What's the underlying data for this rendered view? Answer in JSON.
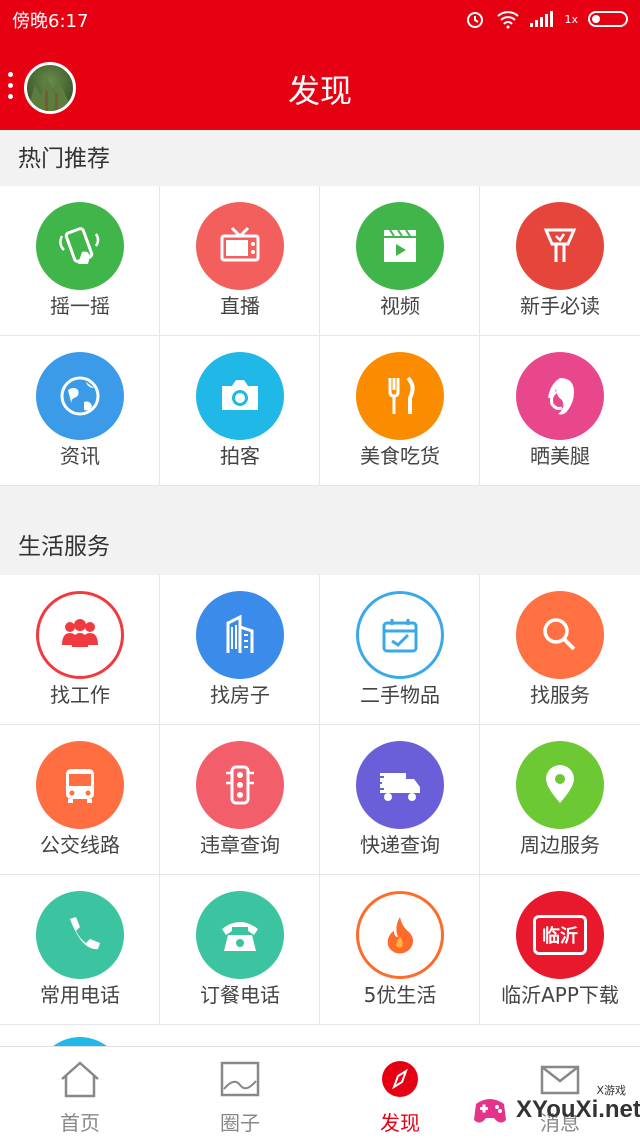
{
  "status": {
    "time": "傍晚6:17",
    "signal": "1x"
  },
  "header": {
    "title": "发现"
  },
  "sections": [
    {
      "title": "热门推荐",
      "items": [
        {
          "label": "摇一摇",
          "icon": "shake-phone-icon",
          "color": "#3fb54a"
        },
        {
          "label": "直播",
          "icon": "tv-icon",
          "color": "#f25f5c"
        },
        {
          "label": "视频",
          "icon": "video-clapper-icon",
          "color": "#3fb54a"
        },
        {
          "label": "新手必读",
          "icon": "guide-icon",
          "color": "#e5453a"
        },
        {
          "label": "资讯",
          "icon": "globe-icon",
          "color": "#3b9be8"
        },
        {
          "label": "拍客",
          "icon": "camera-icon",
          "color": "#20b8e6"
        },
        {
          "label": "美食吃货",
          "icon": "fork-knife-icon",
          "color": "#fb8c00"
        },
        {
          "label": "晒美腿",
          "icon": "woman-face-icon",
          "color": "#e8488b"
        }
      ]
    },
    {
      "title": "生活服务",
      "items": [
        {
          "label": "找工作",
          "icon": "people-group-icon",
          "color": "#f03a40"
        },
        {
          "label": "找房子",
          "icon": "building-icon",
          "color": "#3b8beb"
        },
        {
          "label": "二手物品",
          "icon": "calendar-check-icon",
          "color": "#3aa9e8"
        },
        {
          "label": "找服务",
          "icon": "search-icon",
          "color": "#ff7043"
        },
        {
          "label": "公交线路",
          "icon": "bus-icon",
          "color": "#ff6e40"
        },
        {
          "label": "违章查询",
          "icon": "traffic-light-icon",
          "color": "#f25f6b"
        },
        {
          "label": "快递查询",
          "icon": "truck-icon",
          "color": "#6a5fd8"
        },
        {
          "label": "周边服务",
          "icon": "location-pin-icon",
          "color": "#6cc833"
        },
        {
          "label": "常用电话",
          "icon": "phone-icon",
          "color": "#3cc4a0"
        },
        {
          "label": "订餐电话",
          "icon": "telephone-icon",
          "color": "#3cc4a0"
        },
        {
          "label": "5优生活",
          "icon": "flame-icon",
          "color": "#ff6b2b"
        },
        {
          "label": "临沂APP下载",
          "icon": "linyi-app-icon",
          "color": "#e8192c",
          "icon_text": "临沂"
        }
      ]
    }
  ],
  "tabs": [
    {
      "label": "首页",
      "icon": "home-icon",
      "active": false
    },
    {
      "label": "圈子",
      "icon": "image-icon",
      "active": false
    },
    {
      "label": "发现",
      "icon": "compass-icon",
      "active": true
    },
    {
      "label": "消息",
      "icon": "mail-icon",
      "active": false
    }
  ],
  "watermark": {
    "text": "XYouXi.net",
    "small": "X游戏"
  }
}
